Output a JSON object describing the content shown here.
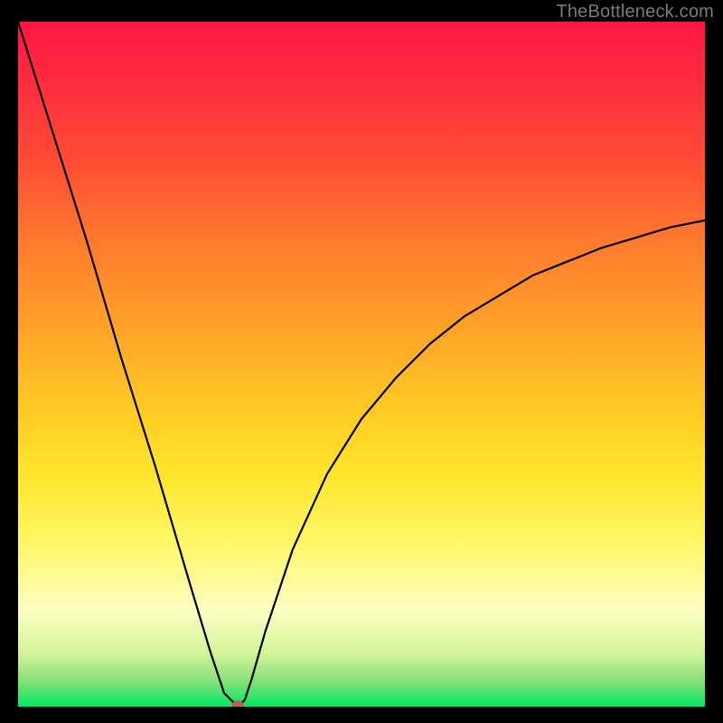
{
  "watermark": "TheBottleneck.com",
  "colors": {
    "background": "#000000",
    "curve": "#000000",
    "marker": "#c75a56",
    "gradient_top": "#ff1744",
    "gradient_bottom": "#00e765"
  },
  "chart_data": {
    "type": "line",
    "title": "",
    "xlabel": "",
    "ylabel": "",
    "xlim": [
      0,
      100
    ],
    "ylim": [
      0,
      100
    ],
    "grid": false,
    "legend": false,
    "x": [
      0,
      5,
      10,
      15,
      20,
      25,
      28,
      30,
      31,
      32,
      33,
      34,
      36,
      40,
      45,
      50,
      55,
      60,
      65,
      70,
      75,
      80,
      85,
      90,
      95,
      100
    ],
    "y": [
      100,
      84,
      68,
      51,
      35,
      18,
      8,
      2,
      1,
      0,
      1,
      4,
      11,
      23,
      34,
      42,
      48,
      53,
      57,
      60,
      63,
      65,
      67,
      68.5,
      70,
      71
    ],
    "series": [
      {
        "name": "bottleneck-curve",
        "values_ref": "xy_above"
      }
    ],
    "marker": {
      "x": 32,
      "y": 0
    },
    "notes": "V-shaped bottleneck curve over rainbow gradient; minimum near x≈32. Values estimated from pixel positions; no axis ticks shown."
  }
}
